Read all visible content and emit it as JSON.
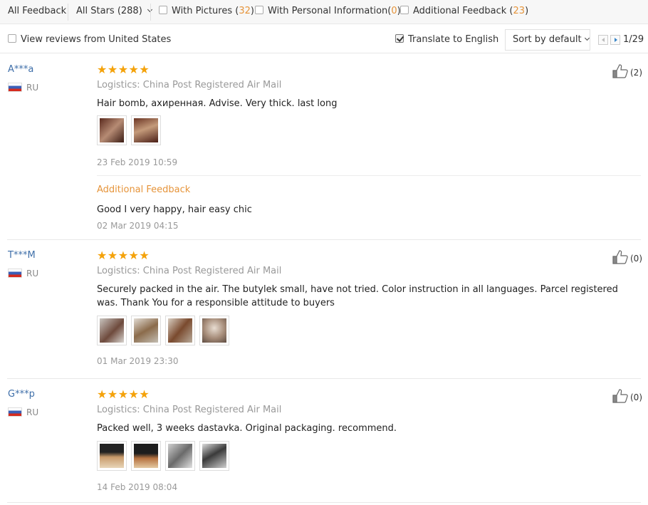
{
  "filters": {
    "all_feedback": "All Feedback",
    "all_stars": "All Stars (288)",
    "with_pictures": "With Pictures (",
    "with_pictures_count": "32",
    "with_personal_info": "With Personal Information(",
    "with_personal_info_count": "0",
    "additional_feedback": "Additional Feedback (",
    "additional_feedback_count": "23",
    "close_paren": ")"
  },
  "toolbar": {
    "view_us": "View reviews from United States",
    "view_us_checked": false,
    "translate": "Translate to English",
    "translate_checked": true,
    "sort": "Sort by default",
    "page": "1/29"
  },
  "reviews": [
    {
      "user": "A***a",
      "country": "RU",
      "stars": "★★★★★",
      "logistics": "Logistics: China Post Registered Air Mail",
      "text": "Hair bomb, ахиренная. Advise. Very thick. last long",
      "photos": 2,
      "date": "23 Feb 2019 10:59",
      "helpful": "(2)",
      "additional": {
        "label": "Additional Feedback",
        "text": "Good I very happy, hair easy chic",
        "date": "02 Mar 2019 04:15"
      }
    },
    {
      "user": "T***M",
      "country": "RU",
      "stars": "★★★★★",
      "logistics": "Logistics: China Post Registered Air Mail",
      "text": "Securely packed in the air. The butylek small, have not tried. Color instruction in all languages. Parcel registered was. Thank You for a responsible attitude to buyers",
      "photos": 4,
      "date": "01 Mar 2019 23:30",
      "helpful": "(0)"
    },
    {
      "user": "G***p",
      "country": "RU",
      "stars": "★★★★★",
      "logistics": "Logistics: China Post Registered Air Mail",
      "text": "Packed well, 3 weeks dastavka. Original packaging. recommend.",
      "photos": 4,
      "date": "14 Feb 2019 08:04",
      "helpful": "(0)"
    }
  ],
  "colors": {
    "accent_orange": "#e6943a",
    "star": "#f4a20a",
    "user_link": "#3f6fa9"
  },
  "icons": {
    "like": "thumbs-up-icon",
    "flag": "russia-flag-icon",
    "prev": "prev-page-icon",
    "next": "next-page-icon"
  }
}
